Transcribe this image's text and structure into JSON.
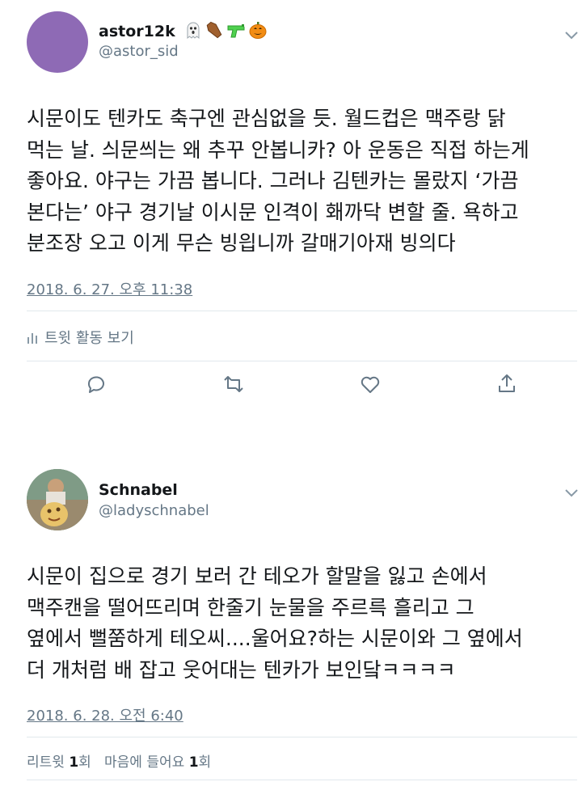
{
  "tweets": [
    {
      "display_name": "astor12k",
      "handle": "@astor_sid",
      "name_icons": [
        "ghost-emoji",
        "coffin-emoji",
        "water-pistol-emoji",
        "jack-o-lantern-emoji"
      ],
      "text_lines": [
        "시문이도 텐카도 축구엔 관심없을 듯. 월드컵은 맥주랑 닭",
        "먹는 날. 싀문씌는 왜 추꾸 안봅니카? 아 운동은 직접 하는게",
        "좋아요. 야구는 가끔 봅니다. 그러나 김텐카는 몰랐지 ‘가끔",
        "본다는’ 야구 경기날 이시문 인격이 홰까닥 변할 줄. 욕하고",
        "분조장 오고 이게 무슨 빙읩니까 갈매기아재 빙의다"
      ],
      "timestamp": "2018. 6. 27. 오후 11:38",
      "activity_label": "트윗 활동 보기"
    },
    {
      "display_name": "Schnabel",
      "handle": "@ladyschnabel",
      "text_lines": [
        "시문이 집으로 경기 보러 간 테오가 할말을 잃고 손에서",
        "맥주캔을 떨어뜨리며 한줄기 눈물을 주르륵 흘리고 그",
        "옆에서 뻘쭘하게 테오씨....울어요?하는 시문이와 그 옆에서",
        "더 개처럼 배 잡고 웃어대는 텐카가 보인닼ㅋㅋㅋㅋ"
      ],
      "timestamp": "2018. 6. 28. 오전 6:40",
      "stats": {
        "retweets_label": "리트윗",
        "retweets_count": "1",
        "retweets_unit": "회",
        "likes_label": "마음에 들어요",
        "likes_count": "1",
        "likes_unit": "회"
      }
    }
  ],
  "colors": {
    "text": "#14171a",
    "secondary": "#657786",
    "divider": "#e1e8ed",
    "avatar1": "#8e6ab5"
  }
}
